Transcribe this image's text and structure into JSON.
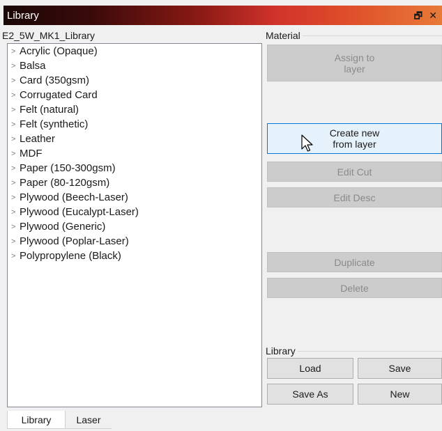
{
  "window": {
    "title": "Library",
    "float_glyph": "🗗",
    "close_glyph": "✕"
  },
  "library_name": "E2_5W_MK1_Library",
  "materials": [
    "Acrylic (Opaque)",
    "Balsa",
    "Card (350gsm)",
    "Corrugated Card",
    "Felt (natural)",
    "Felt (synthetic)",
    "Leather",
    "MDF",
    "Paper (150-300gsm)",
    "Paper (80-120gsm)",
    "Plywood (Beech-Laser)",
    "Plywood (Eucalypt-Laser)",
    "Plywood (Generic)",
    "Plywood (Poplar-Laser)",
    "Polypropylene (Black)"
  ],
  "material_group": {
    "label": "Material",
    "assign_line1": "Assign to",
    "assign_line2": "layer",
    "create_line1": "Create new",
    "create_line2": "from layer",
    "edit_cut": "Edit Cut",
    "edit_desc": "Edit Desc",
    "duplicate": "Duplicate",
    "delete": "Delete"
  },
  "library_group": {
    "label": "Library",
    "load": "Load",
    "save": "Save",
    "save_as": "Save As",
    "new": "New"
  },
  "tabs": [
    "Library",
    "Laser"
  ],
  "colors": {
    "accent_border": "#0078d7",
    "active_button_bg": "#e5f1fb",
    "disabled_button_bg": "#cccccc"
  }
}
